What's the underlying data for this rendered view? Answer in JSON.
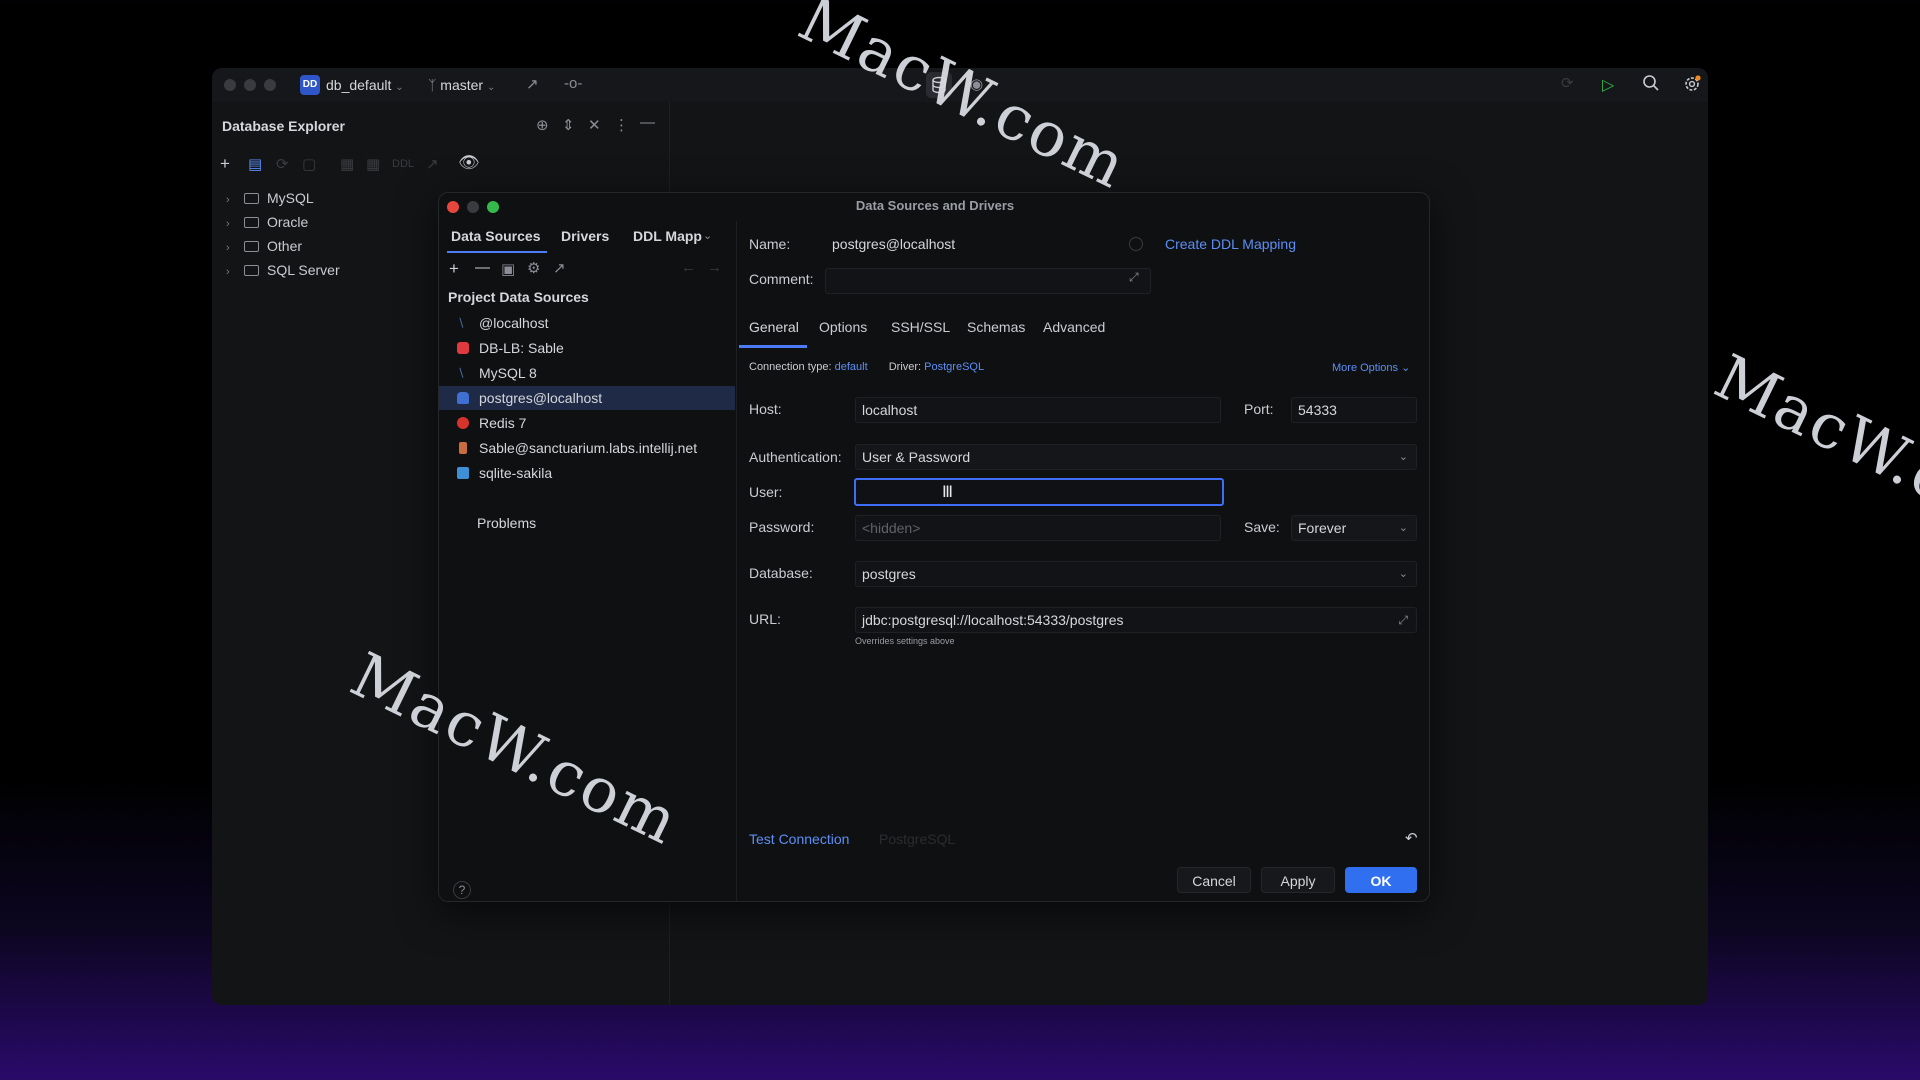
{
  "titlebar": {
    "project_badge": "DD",
    "project_name": "db_default",
    "branch": "master"
  },
  "explorer": {
    "title": "Database Explorer",
    "toolbar_ddl": "DDL",
    "folders": [
      "MySQL",
      "Oracle",
      "Other",
      "SQL Server"
    ]
  },
  "dialog": {
    "title": "Data Sources and Drivers",
    "tabs": [
      "Data Sources",
      "Drivers",
      "DDL Mapp"
    ],
    "section_title": "Project Data Sources",
    "data_sources": [
      {
        "label": "@localhost",
        "icon": "mysql-icon",
        "color": "#4a6fa8"
      },
      {
        "label": "DB-LB: Sable",
        "icon": "oracle-icon",
        "color": "#e0393e"
      },
      {
        "label": "MySQL 8",
        "icon": "mysql-icon",
        "color": "#4a6fa8"
      },
      {
        "label": "postgres@localhost",
        "icon": "postgres-icon",
        "color": "#3f6fd1"
      },
      {
        "label": "Redis 7",
        "icon": "redis-icon",
        "color": "#d6332c"
      },
      {
        "label": "Sable@sanctuarium.labs.intellij.net",
        "icon": "sable-icon",
        "color": "#c76d3e"
      },
      {
        "label": "sqlite-sakila",
        "icon": "sqlite-icon",
        "color": "#3d8fd6"
      }
    ],
    "problems": "Problems",
    "name_label": "Name:",
    "name_value": "postgres@localhost",
    "create_ddl_mapping": "Create DDL Mapping",
    "comment_label": "Comment:",
    "subtabs": [
      "General",
      "Options",
      "SSH/SSL",
      "Schemas",
      "Advanced"
    ],
    "connection_type_label": "Connection type:",
    "connection_type_value": "default",
    "driver_label": "Driver:",
    "driver_value": "PostgreSQL",
    "more_options": "More Options",
    "host_label": "Host:",
    "host_value": "localhost",
    "port_label": "Port:",
    "port_value": "54333",
    "auth_label": "Authentication:",
    "auth_value": "User & Password",
    "user_label": "User:",
    "user_value": "",
    "password_label": "Password:",
    "password_placeholder": "<hidden>",
    "save_label": "Save:",
    "save_value": "Forever",
    "database_label": "Database:",
    "database_value": "postgres",
    "url_label": "URL:",
    "url_value": "jdbc:postgresql://localhost:54333/postgres",
    "url_hint": "Overrides settings above",
    "test_connection": "Test Connection",
    "test_driver": "PostgreSQL",
    "cancel": "Cancel",
    "apply": "Apply",
    "ok": "OK",
    "help": "?"
  },
  "watermarks": [
    "MacW.com",
    "MacW.com",
    "MacW.com"
  ],
  "colors": {
    "accent": "#2f6ff0",
    "link": "#5c8ff5",
    "selection": "#1f2a46",
    "focus": "#3d6ef5"
  }
}
